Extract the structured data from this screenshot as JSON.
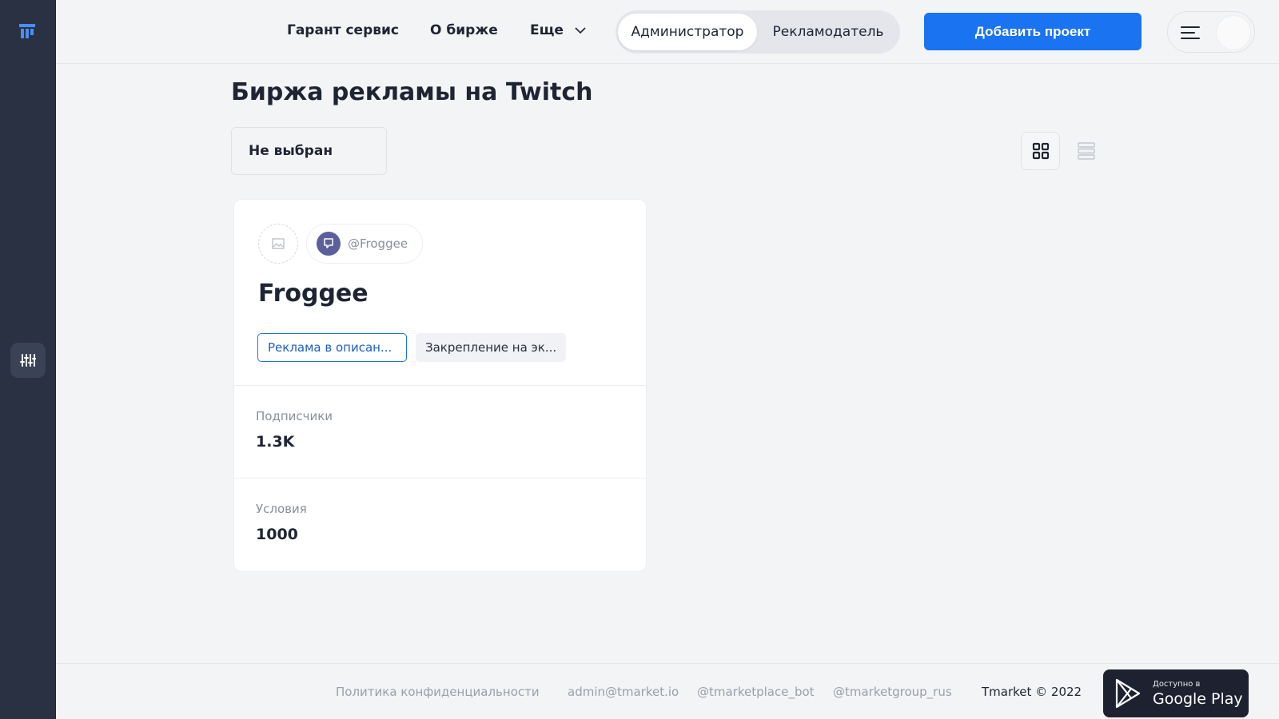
{
  "colors": {
    "accent": "#1a73f0",
    "rail": "#2a3142",
    "twitch": "#5b5f9a"
  },
  "nav": {
    "guarantee": "Гарант сервис",
    "about": "О бирже",
    "more": "Еще"
  },
  "role_toggle": {
    "admin": "Администратор",
    "advertiser": "Рекламодатель",
    "active": "Администратор"
  },
  "add_project_label": "Добавить проект",
  "page": {
    "title": "Биржа рекламы на Twitch",
    "filter_value": "Не выбран",
    "view_mode": "grid"
  },
  "card": {
    "handle": "@Froggee",
    "name": "Froggee",
    "tags": [
      "Реклама в описан...",
      "Закрепление на эк..."
    ],
    "subscribers_label": "Подписчики",
    "subscribers_value": "1.3K",
    "conditions_label": "Условия",
    "conditions_value": "1000"
  },
  "footer": {
    "privacy": "Политика конфиденциальности",
    "email": "admin@tmarket.io",
    "bot": "@tmarketplace_bot",
    "group": "@tmarketgroup_rus",
    "copyright": "Tmarket © 2022",
    "gplay_small": "Доступно в",
    "gplay_big": "Google Play"
  },
  "icons": [
    "logo-icon",
    "filter-sliders-icon",
    "chevron-down-icon",
    "menu-icon",
    "grid-view-icon",
    "list-view-icon",
    "twitch-icon",
    "image-placeholder-icon",
    "google-play-icon"
  ]
}
